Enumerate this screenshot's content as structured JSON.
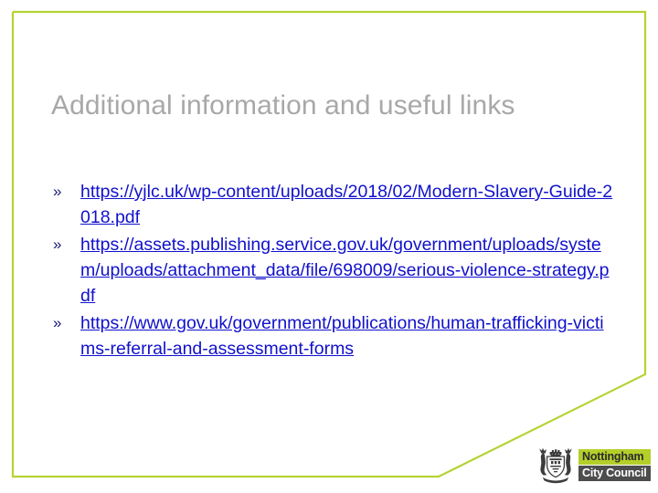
{
  "slide": {
    "title": "Additional information and useful links",
    "accent_color": "#b5d334",
    "title_color": "#a8a8a8",
    "link_color": "#1111cc",
    "bullet_glyph": "»",
    "background_color": "#ffffff"
  },
  "links": [
    {
      "bullet": "»",
      "text": "https://yjlc.uk/wp-content/uploads/2018/02/Modern-Slavery-Guide-2018.pdf"
    },
    {
      "bullet": "»",
      "text": "https://assets.publishing.service.gov.uk/government/uploads/system/uploads/attachment_data/file/698009/serious-violence-strategy.pdf"
    },
    {
      "bullet": "»",
      "text": "https://www.gov.uk/government/publications/human-trafficking-victims-referral-and-assessment-forms"
    }
  ],
  "logo": {
    "crest_name": "nottingham-coat-of-arms",
    "line1": "Nottingham",
    "line2": "City Council",
    "line1_bg": "#b5cf2a",
    "line2_bg": "#4d4d4d"
  }
}
